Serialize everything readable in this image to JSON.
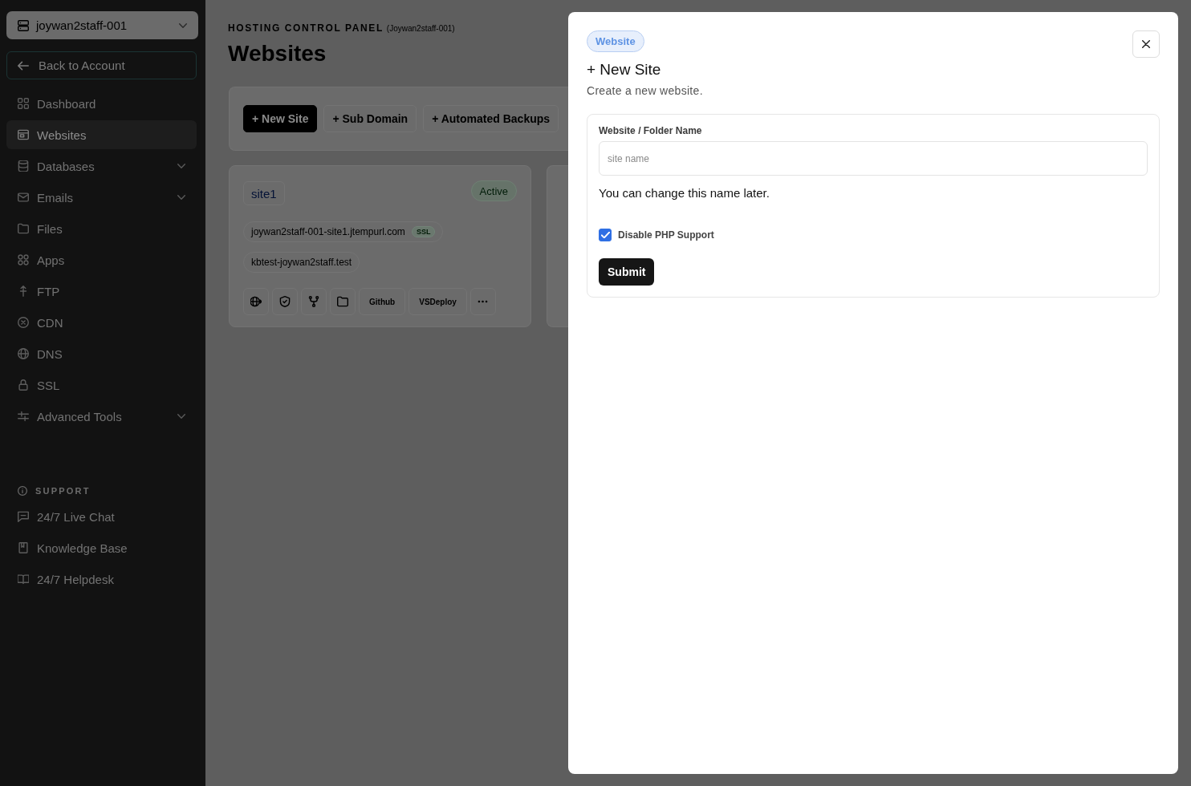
{
  "sidebar": {
    "account_switcher": "joywan2staff-001",
    "back_link": "Back to Account",
    "nav_items": [
      {
        "label": "Dashboard",
        "selected": false,
        "has_submenu": false
      },
      {
        "label": "Websites",
        "selected": true,
        "has_submenu": false
      },
      {
        "label": "Databases",
        "selected": false,
        "has_submenu": true
      },
      {
        "label": "Emails",
        "selected": false,
        "has_submenu": true
      },
      {
        "label": "Files",
        "selected": false,
        "has_submenu": false
      },
      {
        "label": "Apps",
        "selected": false,
        "has_submenu": false
      },
      {
        "label": "FTP",
        "selected": false,
        "has_submenu": false
      },
      {
        "label": "CDN",
        "selected": false,
        "has_submenu": false
      },
      {
        "label": "DNS",
        "selected": false,
        "has_submenu": false
      },
      {
        "label": "SSL",
        "selected": false,
        "has_submenu": false
      },
      {
        "label": "Advanced Tools",
        "selected": false,
        "has_submenu": true
      }
    ],
    "support": {
      "heading": "SUPPORT",
      "items": [
        "24/7 Live Chat",
        "Knowledge Base",
        "24/7 Helpdesk"
      ]
    }
  },
  "main": {
    "eyebrow": "HOSTING CONTROL PANEL",
    "account": "(Joywan2staff-001)",
    "title": "Websites",
    "toolbar": [
      {
        "label": "+ New Site",
        "primary": true
      },
      {
        "label": "+ Sub Domain",
        "primary": false
      },
      {
        "label": "+ Automated Backups",
        "primary": false
      }
    ],
    "sites": [
      {
        "hidden_by_dialog": false,
        "name": "site1",
        "status": "Active",
        "domains": [
          {
            "host": "joywan2staff-001-site1.jtempurl.com",
            "badge": "SSL"
          },
          {
            "host": "kbtest-joywan2staff.test"
          }
        ],
        "actions": [
          {
            "kind": "icon"
          },
          {
            "kind": "icon"
          },
          {
            "kind": "icon"
          },
          {
            "kind": "icon"
          },
          {
            "kind": "text",
            "label": "Github"
          },
          {
            "kind": "text",
            "label": "VSDeploy"
          },
          {
            "kind": "more"
          }
        ]
      },
      {
        "hidden_by_dialog": true
      }
    ]
  },
  "dialog": {
    "tag": "Website",
    "title": "+ New Site",
    "subtitle": "Create a new website.",
    "form": {
      "field_label": "Website / Folder Name",
      "placeholder": "site name",
      "hint": "You can change this name later.",
      "checkbox": {
        "label": "Disable PHP Support",
        "checked": true
      },
      "submit": "Submit"
    }
  }
}
